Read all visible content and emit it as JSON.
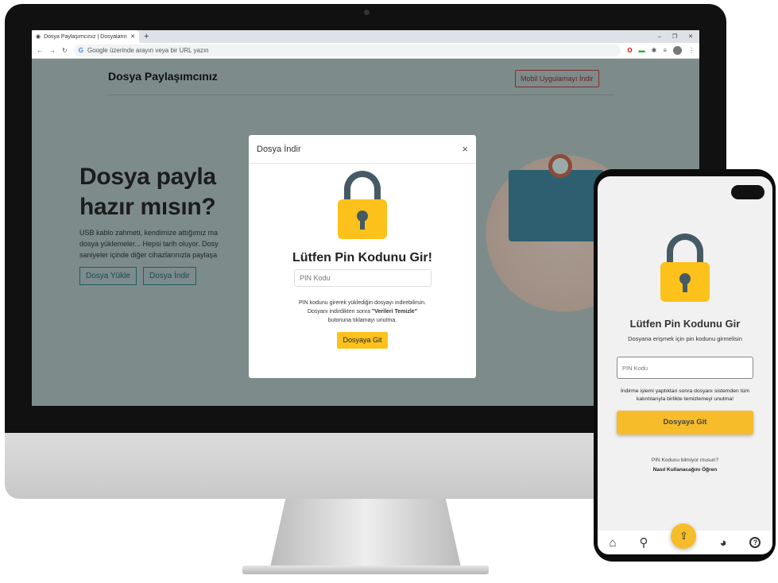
{
  "browser": {
    "tab_title": "Dosya Paylaşımcınız | Dosyalarını",
    "new_tab": "+",
    "address_placeholder": "Google üzerinde arayın veya bir URL yazın",
    "window_controls": [
      "–",
      "❐",
      "✕"
    ]
  },
  "site": {
    "brand": "Dosya Paylaşımcınız",
    "mobile_app_button": "Mobil Uygulamayı İndir",
    "hero_line1": "Dosya payla",
    "hero_line2": "hazır mısın?",
    "hero_text": [
      "USB kablo zahmeti, kendimize attığımız ma",
      "dosya yüklemeler... Hepsi tarih oluyor. Dosy",
      "saniyeler içinde diğer cihazlarınızla paylaşa"
    ],
    "upload_button": "Dosya Yükle",
    "download_button": "Dosya İndir"
  },
  "modal": {
    "title": "Dosya İndir",
    "close": "×",
    "heading": "Lütfen Pin Kodunu Gir!",
    "pin_placeholder": "PIN Kodu",
    "info_line1": "PIN kodunu girerek yüklediğin dosyayı indirebilirsin.",
    "info_line2": "Dosyanı indirdikten sonra ",
    "info_bold": "\"Verileri Temizle\"",
    "info_line3": "butonuna tıklamayı unutma.",
    "submit": "Dosyaya Git"
  },
  "phone": {
    "heading": "Lütfen Pin Kodunu Gir",
    "subheading": "Dosyana erişmek için pin kodunu girmelisin",
    "pin_placeholder": "PIN Kodu",
    "warning": "İndirme işlemi yaptıktan sonra dosyanı sistemden tüm kalıntılarıyla birlikte temizlemeyi unutma!",
    "submit": "Dosyaya Git",
    "help_question": "PIN Kodunu bilmiyor musun?",
    "help_link": "Nasıl Kullanacağını Öğren",
    "nav": [
      "home-icon",
      "search-icon",
      "upload-icon",
      "globe-icon",
      "help-icon"
    ]
  },
  "colors": {
    "accent": "#fcc21b",
    "lock_shackle": "#455a64",
    "teal": "#2a8a8a"
  }
}
